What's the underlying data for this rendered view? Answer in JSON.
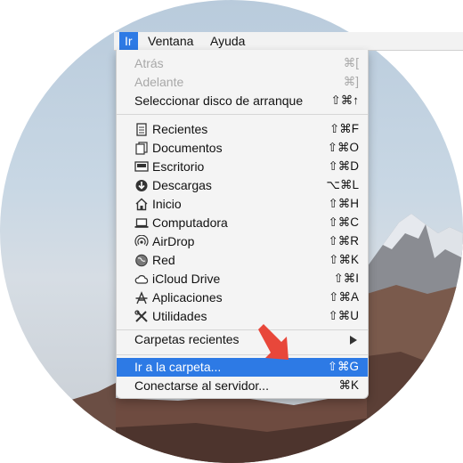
{
  "menubar": {
    "items": [
      "Ir",
      "Ventana",
      "Ayuda"
    ]
  },
  "menu": {
    "back": {
      "label": "Atrás",
      "shortcut": "⌘["
    },
    "forward": {
      "label": "Adelante",
      "shortcut": "⌘]"
    },
    "startup_disk": {
      "label": "Seleccionar disco de arranque",
      "shortcut": "⇧⌘↑"
    },
    "places": [
      {
        "label": "Recientes",
        "shortcut": "⇧⌘F",
        "icon": "recents-icon"
      },
      {
        "label": "Documentos",
        "shortcut": "⇧⌘O",
        "icon": "documents-icon"
      },
      {
        "label": "Escritorio",
        "shortcut": "⇧⌘D",
        "icon": "desktop-icon"
      },
      {
        "label": "Descargas",
        "shortcut": "⌥⌘L",
        "icon": "downloads-icon"
      },
      {
        "label": "Inicio",
        "shortcut": "⇧⌘H",
        "icon": "home-icon"
      },
      {
        "label": "Computadora",
        "shortcut": "⇧⌘C",
        "icon": "computer-icon"
      },
      {
        "label": "AirDrop",
        "shortcut": "⇧⌘R",
        "icon": "airdrop-icon"
      },
      {
        "label": "Red",
        "shortcut": "⇧⌘K",
        "icon": "network-icon"
      },
      {
        "label": "iCloud Drive",
        "shortcut": "⇧⌘I",
        "icon": "icloud-icon"
      },
      {
        "label": "Aplicaciones",
        "shortcut": "⇧⌘A",
        "icon": "applications-icon"
      },
      {
        "label": "Utilidades",
        "shortcut": "⇧⌘U",
        "icon": "utilities-icon"
      }
    ],
    "recent_folders": {
      "label": "Carpetas recientes"
    },
    "go_to_folder": {
      "label": "Ir a la carpeta...",
      "shortcut": "⇧⌘G"
    },
    "connect_server": {
      "label": "Conectarse al servidor...",
      "shortcut": "⌘K"
    }
  },
  "colors": {
    "highlight": "#2d7ae5",
    "pointer": "#e8473a"
  }
}
